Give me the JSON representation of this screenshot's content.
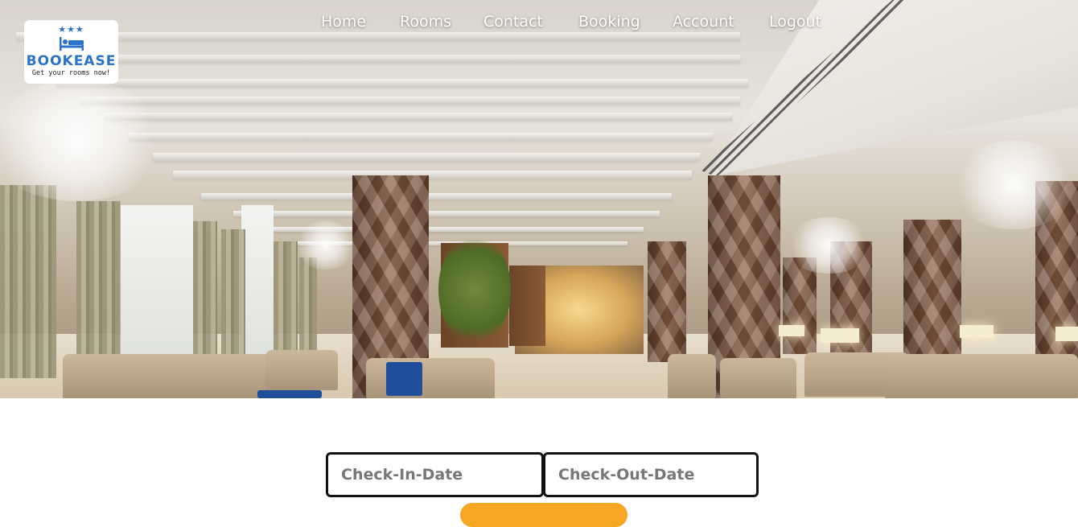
{
  "brand": {
    "stars": "★★★",
    "name": "BOOKEASE",
    "tagline": "Get your rooms now!",
    "accent_color": "#2a73c9"
  },
  "nav": {
    "items": [
      {
        "label": "Home"
      },
      {
        "label": "Rooms"
      },
      {
        "label": "Contact"
      },
      {
        "label": "Booking"
      },
      {
        "label": "Account"
      },
      {
        "label": "Logout"
      }
    ]
  },
  "hero": {
    "description_icon": "hotel-lobby-image"
  },
  "booking": {
    "check_in_placeholder": "Check-In-Date",
    "check_out_placeholder": "Check-Out-Date",
    "button_color": "#f5a623"
  }
}
